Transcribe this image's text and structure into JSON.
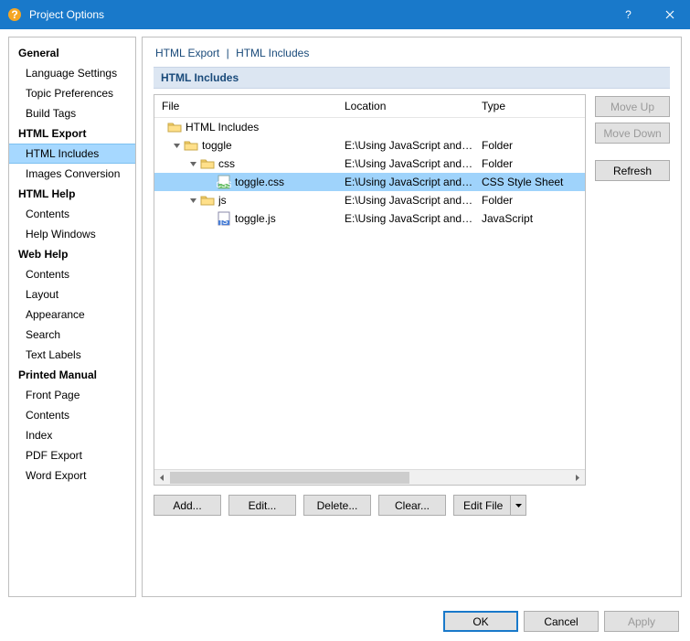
{
  "window": {
    "title": "Project Options",
    "help_label": "?",
    "close_label": "×"
  },
  "nav": {
    "sections": [
      {
        "label": "General",
        "items": [
          "Language Settings",
          "Topic Preferences",
          "Build Tags"
        ]
      },
      {
        "label": "HTML Export",
        "items": [
          "HTML Includes",
          "Images Conversion"
        ],
        "selectedIndex": 0
      },
      {
        "label": "HTML Help",
        "items": [
          "Contents",
          "Help Windows"
        ]
      },
      {
        "label": "Web Help",
        "items": [
          "Contents",
          "Layout",
          "Appearance",
          "Search",
          "Text Labels"
        ]
      },
      {
        "label": "Printed Manual",
        "items": [
          "Front Page",
          "Contents",
          "Index",
          "PDF Export",
          "Word Export"
        ]
      }
    ]
  },
  "breadcrumb": {
    "a": "HTML Export",
    "b": "HTML Includes",
    "sep": "|"
  },
  "section": {
    "title": "HTML Includes"
  },
  "tree": {
    "headers": {
      "file": "File",
      "location": "Location",
      "type": "Type"
    },
    "rows": [
      {
        "depth": 0,
        "twisty": "none",
        "icon": "folder",
        "name": "HTML Includes",
        "location": "",
        "type": ""
      },
      {
        "depth": 1,
        "twisty": "open",
        "icon": "folderOpen",
        "name": "toggle",
        "location": "E:\\Using JavaScript and C…",
        "type": "Folder"
      },
      {
        "depth": 2,
        "twisty": "open",
        "icon": "folderOpen",
        "name": "css",
        "location": "E:\\Using JavaScript and C…",
        "type": "Folder"
      },
      {
        "depth": 3,
        "twisty": "none",
        "icon": "css",
        "name": "toggle.css",
        "location": "E:\\Using JavaScript and C…",
        "type": "CSS Style Sheet",
        "selected": true
      },
      {
        "depth": 2,
        "twisty": "open",
        "icon": "folderOpen",
        "name": "js",
        "location": "E:\\Using JavaScript and C…",
        "type": "Folder"
      },
      {
        "depth": 3,
        "twisty": "none",
        "icon": "js",
        "name": "toggle.js",
        "location": "E:\\Using JavaScript and C…",
        "type": "JavaScript"
      }
    ]
  },
  "buttons": {
    "add": "Add...",
    "edit": "Edit...",
    "delete": "Delete...",
    "clear": "Clear...",
    "editfile": "Edit File",
    "moveup": "Move Up",
    "movedown": "Move Down",
    "refresh": "Refresh"
  },
  "footer": {
    "ok": "OK",
    "cancel": "Cancel",
    "apply": "Apply"
  }
}
